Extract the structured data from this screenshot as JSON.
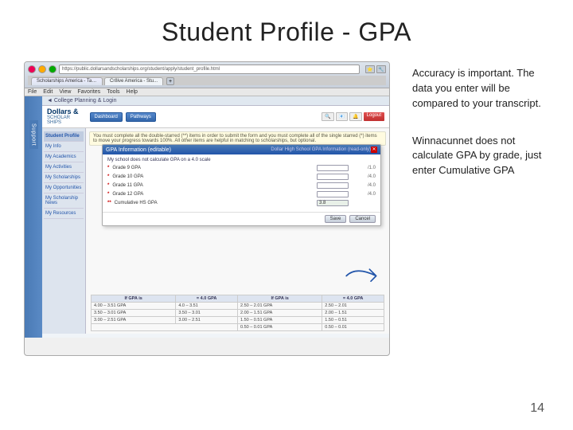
{
  "page": {
    "title": "Student Profile - GPA",
    "page_number": "14"
  },
  "browser": {
    "url": "https://public.dollarsandscholarships.org/student/apply/student_profile.html",
    "tab1": "Scholarships America - Tab...",
    "tab2": "Cr8ive America - Stu...",
    "menu_items": [
      "File",
      "Edit",
      "View",
      "Favorites",
      "Tools",
      "Help"
    ],
    "nav_back": "◄",
    "nav_forward": "►"
  },
  "app": {
    "logo_line1": "Dollars &",
    "logo_line2": "SCHOLAR",
    "logo_line3": "SHIPS",
    "breadcrumb": "◄ College Planning & Login",
    "sidebar_tab": "Support",
    "nav_items": [
      {
        "label": "Student Profile",
        "active": true
      },
      {
        "label": "My Info"
      },
      {
        "label": "My Academics"
      },
      {
        "label": "My Activities"
      },
      {
        "label": "My Scholarships"
      },
      {
        "label": "My Opportunities"
      },
      {
        "label": "My Scholarship News"
      },
      {
        "label": "My Resources"
      }
    ],
    "notification": "You must complete all the double-starred (**) items in order to submit the form and you must complete all of the single starred (*) items to move your progress towards 100%. All other items are helpful in matching to scholarships, but optional."
  },
  "gpa_dialog": {
    "title": "GPA Information (editable)",
    "title2": "Dollar High School GPA Information (read-only)",
    "subtitle": "My school does not calculate GPA on a 4.0 scale",
    "rows": [
      {
        "label": "* Grade 9 GPA",
        "required": true,
        "value": "/1.0"
      },
      {
        "label": "* Grade 10 GPA",
        "required": true,
        "value": "/4.0"
      },
      {
        "label": "* Grade 11 GPA",
        "required": true,
        "value": "/4.0"
      },
      {
        "label": "* Grade 12 GPA",
        "required": true,
        "value": "/4.0"
      },
      {
        "label": "** Cumulative HS GPA",
        "required": true,
        "value": "3.8"
      }
    ],
    "buttons": [
      "Save",
      "Cancel"
    ]
  },
  "gpa_table": {
    "header": [
      "If GPA is",
      "= 4.0 GPA"
    ],
    "rows": [
      [
        "4.00 - 3.51 GPA",
        "= 4.0 - 3.51"
      ],
      [
        "3.50 - 3.01 GPA",
        "= 3.50 - 3.01"
      ],
      [
        "3.00 - 2.51 GPA",
        "= 3.00 - 2.51"
      ],
      [
        "2.50 - 2.01 GPA",
        "= 2.50 - 2.01"
      ],
      [
        "2.00 - 1.51 GPA",
        "= 2.00 - 1.51"
      ],
      [
        "1.50 - 0.51 GPA",
        "= 1.50 - 0.51"
      ],
      [
        "0.50 - 0.01 GPA",
        "= 0.50 - 0.01"
      ]
    ]
  },
  "annotations": {
    "first": "Accuracy is important. The data you enter will be compared to your transcript.",
    "second": "Winnacunnet does not calculate GPA by grade, just enter Cumulative GPA"
  }
}
